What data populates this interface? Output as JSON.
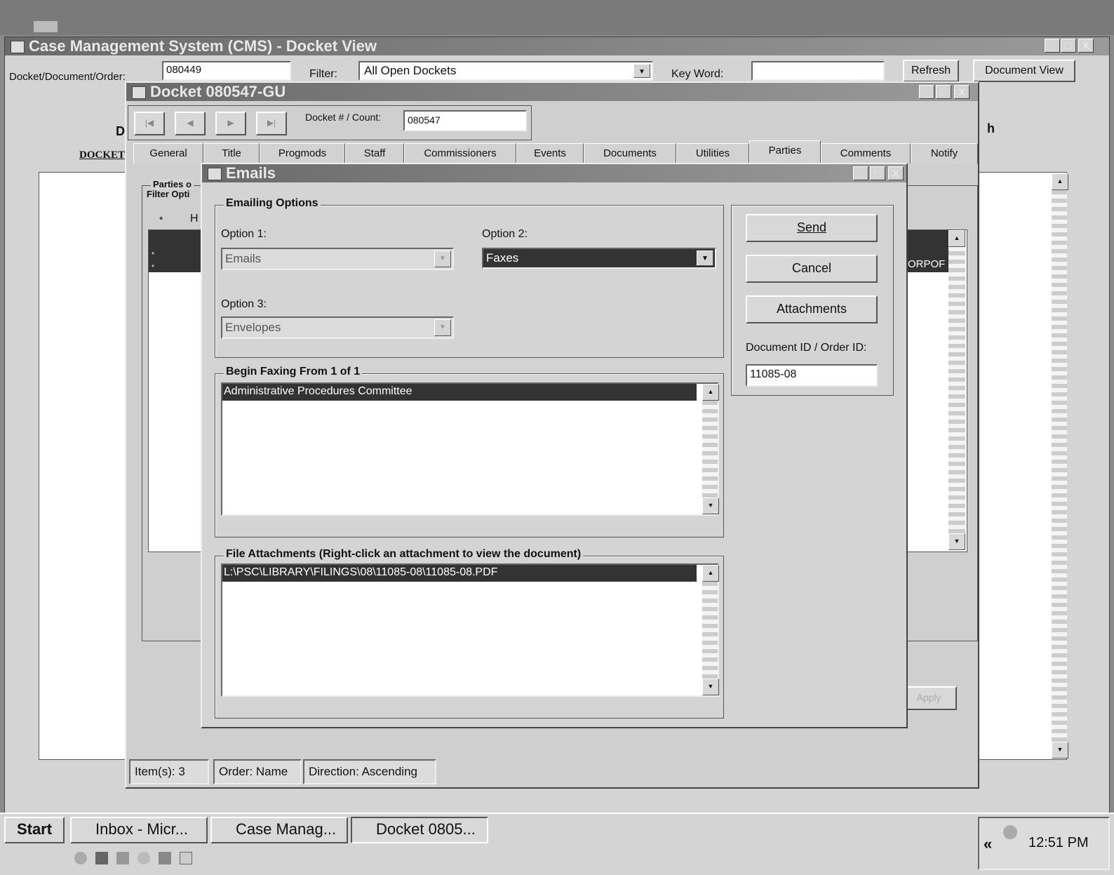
{
  "main_window": {
    "title": "Case Management System (CMS) - Docket View",
    "docket_label": "Docket/Document/Order:",
    "docket_value": "080449",
    "filter_label": "Filter:",
    "filter_value": "All Open Dockets",
    "keyword_label": "Key Word:",
    "keyword_value": "",
    "refresh_label": "Refresh",
    "document_view_label": "Document View",
    "bg_d": "D",
    "bg_h": "h",
    "bg_docket": "DOCKET"
  },
  "docket_window": {
    "title": "Docket 080547-GU",
    "count_label": "Docket # / Count:",
    "count_value": "080547",
    "tabs": [
      "General",
      "Title",
      "Progmods",
      "Staff",
      "Commissioners",
      "Events",
      "Documents",
      "Utilities",
      "Parties",
      "Comments",
      "Notify"
    ],
    "parties_label": "Parties o",
    "filter_opt_label": "Filter Opti",
    "col_star": "*",
    "col_h": "H",
    "row_star_1": "*",
    "row_star_2": "*",
    "corp_partial": "ORPOF",
    "apply_label": "Apply",
    "status_items": "Item(s):  3",
    "status_order": "Order:  Name",
    "status_direction": "Direction:  Ascending"
  },
  "emails_window": {
    "title": "Emails",
    "options_group": "Emailing Options",
    "option1_label": "Option 1:",
    "option1_value": "Emails",
    "option2_label": "Option 2:",
    "option2_value": "Faxes",
    "option3_label": "Option 3:",
    "option3_value": "Envelopes",
    "begin_group": "Begin Faxing From 1 of 1",
    "begin_items": [
      "Administrative Procedures Committee"
    ],
    "attach_group": "File Attachments (Right-click an attachment to view the document)",
    "attach_items": [
      "L:\\PSC\\LIBRARY\\FILINGS\\08\\11085-08\\11085-08.PDF"
    ],
    "send_label": "Send",
    "cancel_label": "Cancel",
    "attachments_label": "Attachments",
    "docid_label": "Document ID / Order ID:",
    "docid_value": "11085-08"
  },
  "taskbar": {
    "start_label": "Start",
    "items": [
      "Inbox - Micr...",
      "Case Manag...",
      "Docket 0805..."
    ],
    "clock": "12:51 PM",
    "chevron": "«"
  },
  "icons": {
    "min": "_",
    "max": "□",
    "close": "X",
    "first": "|◀",
    "prev": "◀",
    "next": "▶",
    "last": "▶|",
    "down": "▼",
    "up": "▲"
  }
}
